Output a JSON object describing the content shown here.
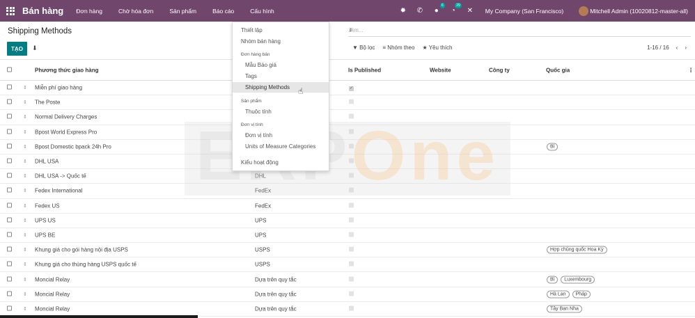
{
  "app": {
    "title": "Bán hàng"
  },
  "menu": [
    "Đơn hàng",
    "Chờ hóa đơn",
    "Sản phẩm",
    "Báo cáo",
    "Cấu hình"
  ],
  "topbar": {
    "msg_badge": "6",
    "activity_badge": "29",
    "company": "My Company (San Francisco)",
    "user": "Mitchell Admin (10020812-master-all)"
  },
  "page": {
    "title": "Shipping Methods",
    "create_label": "TẠO"
  },
  "search": {
    "placeholder": "Tìm..."
  },
  "filters": {
    "filter": "Bộ lọc",
    "group": "Nhóm theo",
    "fav": "Yêu thích"
  },
  "pager": {
    "range": "1-16 / 16"
  },
  "columns": {
    "name": "Phương thức giao hàng",
    "published": "Is Published",
    "website": "Website",
    "company": "Công ty",
    "country": "Quốc gia"
  },
  "rows": [
    {
      "name": "Miễn phí giao hàng",
      "provider": "",
      "published": true,
      "tags": []
    },
    {
      "name": "The Poste",
      "provider": "",
      "published": false,
      "tags": []
    },
    {
      "name": "Normal Delivery Charges",
      "provider": "",
      "published": false,
      "tags": []
    },
    {
      "name": "Bpost World Express Pro",
      "provider": "",
      "published": false,
      "tags": []
    },
    {
      "name": "Bpost Domestic bpack 24h Pro",
      "provider": "",
      "published": false,
      "tags": [
        "Bỉ"
      ]
    },
    {
      "name": "DHL USA",
      "provider": "",
      "published": false,
      "tags": []
    },
    {
      "name": "DHL USA -> Quốc tế",
      "provider": "DHL",
      "published": false,
      "tags": []
    },
    {
      "name": "Fedex International",
      "provider": "FedEx",
      "published": false,
      "tags": []
    },
    {
      "name": "Fedex US",
      "provider": "FedEx",
      "published": false,
      "tags": []
    },
    {
      "name": "UPS US",
      "provider": "UPS",
      "published": false,
      "tags": []
    },
    {
      "name": "UPS BE",
      "provider": "UPS",
      "published": false,
      "tags": []
    },
    {
      "name": "Khung giá cho gói hàng nội địa USPS",
      "provider": "USPS",
      "published": false,
      "tags": [
        "Hợp chủng quốc Hoa Kỳ"
      ]
    },
    {
      "name": "Khung giá cho thùng hàng USPS quốc tế",
      "provider": "USPS",
      "published": false,
      "tags": []
    },
    {
      "name": "Moncial Relay",
      "provider": "Dựa trên quy tắc",
      "published": false,
      "tags": [
        "Bỉ",
        "Luxembourg"
      ]
    },
    {
      "name": "Moncial Relay",
      "provider": "Dựa trên quy tắc",
      "published": false,
      "tags": [
        "Hà Lan",
        "Pháp"
      ]
    },
    {
      "name": "Moncial Relay",
      "provider": "Dựa trên quy tắc",
      "published": false,
      "tags": [
        "Tây Ban Nha"
      ]
    }
  ],
  "dropdown": {
    "setup": "Thiết lập",
    "sales_teams": "Nhóm bán hàng",
    "orders_header": "Đơn hàng bán",
    "quote_templates": "Mẫu Báo giá",
    "tags": "Tags",
    "shipping_methods": "Shipping Methods",
    "products_header": "Sản phẩm",
    "attributes": "Thuộc tính",
    "uom_header": "Đơn vị tính",
    "uom": "Đơn vị tính",
    "uom_categories": "Units of Measure Categories",
    "activity_types": "Kiểu hoạt động"
  },
  "watermark": {
    "left": "ERP",
    "right": "One"
  }
}
